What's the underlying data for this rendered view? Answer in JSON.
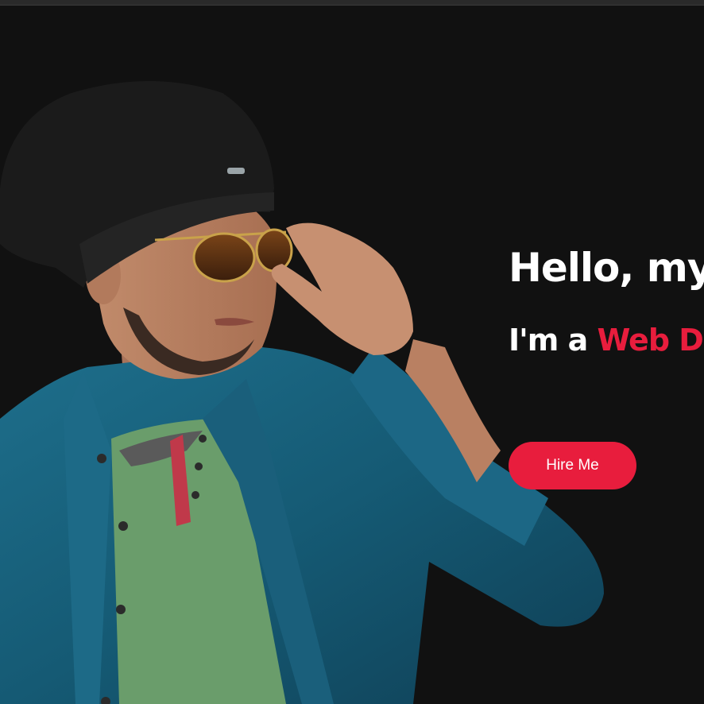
{
  "hero": {
    "greeting": "Hello, my",
    "role_prefix": "I'm a ",
    "role_highlight": "Web D",
    "cta_label": "Hire Me"
  },
  "colors": {
    "background": "#111111",
    "accent": "#e81d3d",
    "text": "#ffffff"
  }
}
